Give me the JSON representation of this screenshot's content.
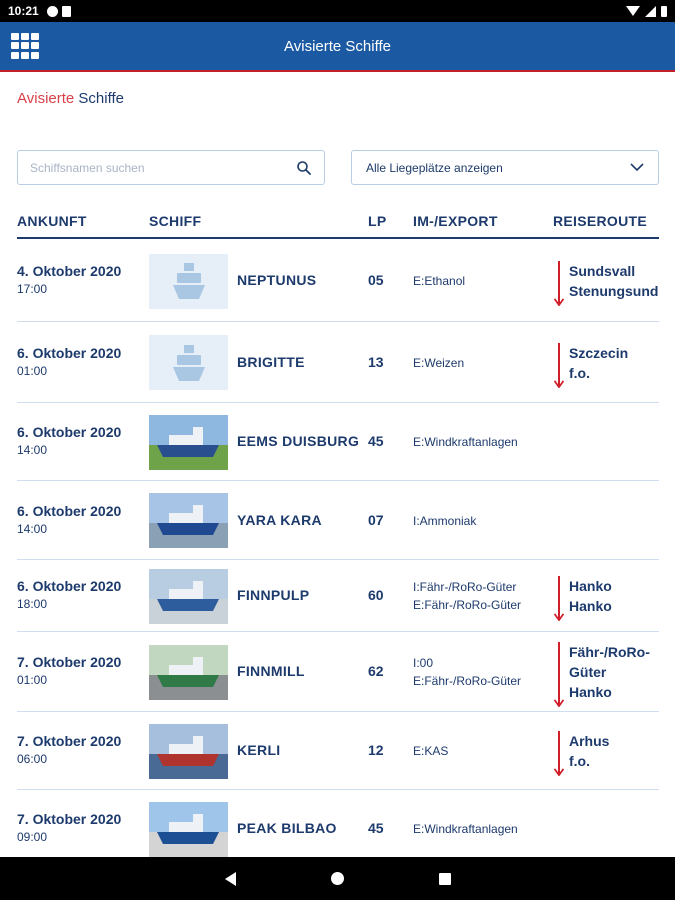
{
  "status_bar": {
    "time": "10:21"
  },
  "app_bar": {
    "title": "Avisierte Schiffe",
    "menu_icon": "grid-icon"
  },
  "breadcrumb": {
    "part1": "Avisierte",
    "part2": "Schiffe"
  },
  "search": {
    "placeholder": "Schiffsnamen suchen",
    "value": ""
  },
  "berth_select": {
    "selected": "Alle Liegeplätze anzeigen"
  },
  "table": {
    "headers": {
      "arrival": "ANKUNFT",
      "ship": "SCHIFF",
      "lp": "LP",
      "imex": "IM-/EXPORT",
      "route": "REISEROUTE"
    },
    "rows": [
      {
        "date": "4. Oktober 2020",
        "time": "17:00",
        "ship": "NEPTUNUS",
        "image": "placeholder",
        "lp": "05",
        "imex": [
          "E:Ethanol"
        ],
        "route": [
          "Sundsvall",
          "Stenungsund"
        ]
      },
      {
        "date": "6. Oktober 2020",
        "time": "01:00",
        "ship": "BRIGITTE",
        "image": "placeholder",
        "lp": "13",
        "imex": [
          "E:Weizen"
        ],
        "route": [
          "Szczecin",
          "f.o."
        ]
      },
      {
        "date": "6. Oktober 2020",
        "time": "14:00",
        "ship": "EEMS DUISBURG",
        "image": "photo",
        "lp": "45",
        "imex": [
          "E:Windkraftanlagen"
        ],
        "route": []
      },
      {
        "date": "6. Oktober 2020",
        "time": "14:00",
        "ship": "YARA KARA",
        "image": "photo",
        "lp": "07",
        "imex": [
          "I:Ammoniak"
        ],
        "route": []
      },
      {
        "date": "6. Oktober 2020",
        "time": "18:00",
        "ship": "FINNPULP",
        "image": "photo",
        "lp": "60",
        "imex": [
          "I:Fähr-/RoRo-Güter",
          "E:Fähr-/RoRo-Güter"
        ],
        "route": [
          "Hanko",
          "Hanko"
        ]
      },
      {
        "date": "7. Oktober 2020",
        "time": "01:00",
        "ship": "FINNMILL",
        "image": "photo",
        "lp": "62",
        "imex": [
          "I:00",
          "E:Fähr-/RoRo-Güter"
        ],
        "route": [
          "Fähr-/RoRo-",
          "Güter",
          "Hanko"
        ]
      },
      {
        "date": "7. Oktober 2020",
        "time": "06:00",
        "ship": "KERLI",
        "image": "photo",
        "lp": "12",
        "imex": [
          "E:KAS"
        ],
        "route": [
          "Arhus",
          "f.o."
        ]
      },
      {
        "date": "7. Oktober 2020",
        "time": "09:00",
        "ship": "PEAK BILBAO",
        "image": "photo",
        "lp": "45",
        "imex": [
          "E:Windkraftanlagen"
        ],
        "route": []
      }
    ]
  },
  "colors": {
    "brand_blue": "#1b5aa3",
    "accent_red": "#c3202a",
    "text_navy": "#1d3a6c"
  }
}
